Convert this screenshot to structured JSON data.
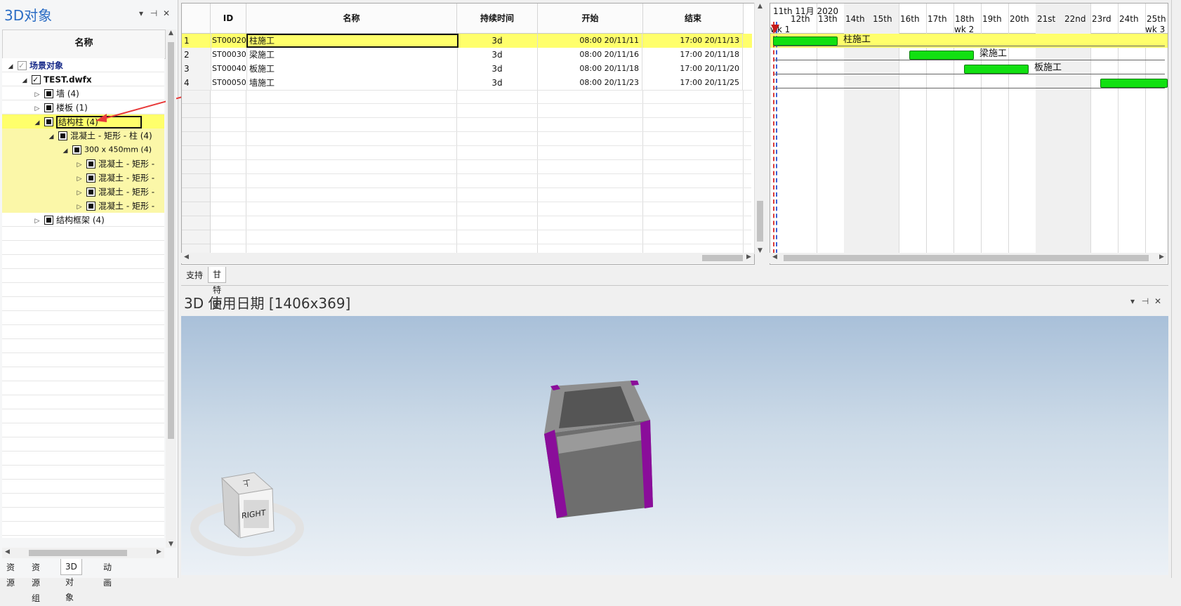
{
  "left_panel": {
    "title": "3D对象",
    "column_header": "名称",
    "tree": [
      {
        "label": "场景对象",
        "expander": "◢",
        "check": "grey"
      },
      {
        "label": "TEST.dwfx",
        "expander": "◢",
        "check": "check"
      },
      {
        "label": "墙 (4)",
        "expander": "▷",
        "check": "filled"
      },
      {
        "label": "楼板 (1)",
        "expander": "▷",
        "check": "filled"
      },
      {
        "label": "结构柱 (4)",
        "expander": "◢",
        "check": "filled"
      },
      {
        "label": "混凝土 - 矩形 - 柱 (4)",
        "expander": "◢",
        "check": "filled"
      },
      {
        "label": "300 x 450mm (4)",
        "expander": "◢",
        "check": "filled"
      },
      {
        "label": "混凝土 - 矩形 -",
        "expander": "▷",
        "check": "filled"
      },
      {
        "label": "混凝土 - 矩形 -",
        "expander": "▷",
        "check": "filled"
      },
      {
        "label": "混凝土 - 矩形 -",
        "expander": "▷",
        "check": "filled"
      },
      {
        "label": "混凝土 - 矩形 -",
        "expander": "▷",
        "check": "filled"
      },
      {
        "label": "结构框架 (4)",
        "expander": "▷",
        "check": "filled"
      }
    ],
    "tabs": [
      "资源",
      "资源组",
      "3D对象",
      "动画"
    ],
    "active_tab": "3D对象"
  },
  "pane_controls": {
    "dropdown": "▾",
    "pin": "⊣",
    "close": "✕"
  },
  "grid": {
    "columns": [
      "ID",
      "名称",
      "持续时间",
      "开始",
      "结束"
    ],
    "rows": [
      {
        "num": "1",
        "id": "ST00020",
        "name": "柱施工",
        "duration": "3d",
        "start": "08:00 20/11/11",
        "end": "17:00 20/11/13"
      },
      {
        "num": "2",
        "id": "ST00030",
        "name": "梁施工",
        "duration": "3d",
        "start": "08:00 20/11/16",
        "end": "17:00 20/11/18"
      },
      {
        "num": "3",
        "id": "ST00040",
        "name": "板施工",
        "duration": "3d",
        "start": "08:00 20/11/18",
        "end": "17:00 20/11/20"
      },
      {
        "num": "4",
        "id": "ST00050",
        "name": "墙施工",
        "duration": "3d",
        "start": "08:00 20/11/23",
        "end": "17:00 20/11/25"
      }
    ],
    "selected_row": 1
  },
  "mid_tabs": [
    "支持",
    "甘特图"
  ],
  "mid_active_tab": "甘特图",
  "gantt": {
    "month_label": "11th 11月 2020",
    "days": [
      "12th",
      "13th",
      "14th",
      "15th",
      "16th",
      "17th",
      "18th",
      "19th",
      "20th",
      "21st",
      "22nd",
      "23rd",
      "24th",
      "25th"
    ],
    "weeks": [
      "wk 1",
      "wk 2",
      "wk 3"
    ],
    "tasks": [
      {
        "label": "柱施工"
      },
      {
        "label": "梁施工"
      },
      {
        "label": "板施工"
      },
      {
        "label": ""
      }
    ],
    "bar_color": "#11e011"
  },
  "view": {
    "title": "3D 使用日期  [1406x369]",
    "viewcube_face": "RIGHT",
    "viewcube_top": "上",
    "column_color": "#8a0d9a"
  }
}
